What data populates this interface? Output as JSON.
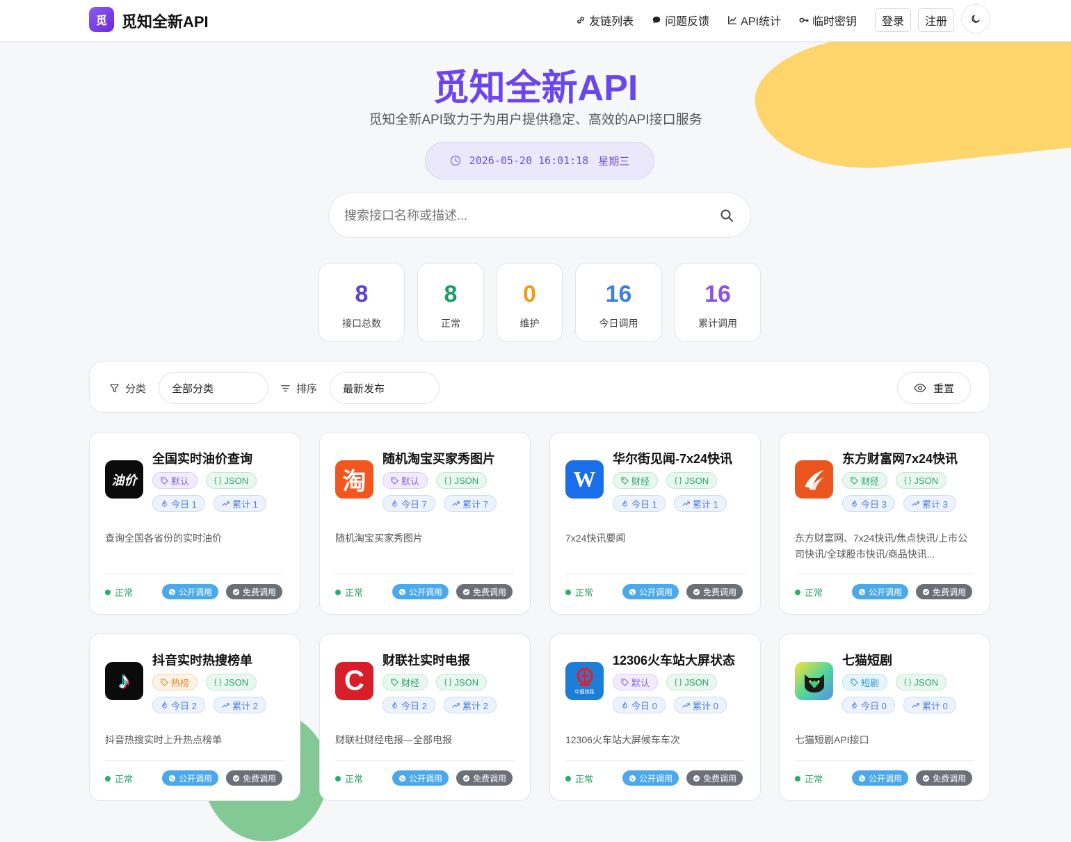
{
  "nav": {
    "brand_icon_text": "觅",
    "brand": "觅知全新API",
    "links": [
      "友链列表",
      "问题反馈",
      "API统计",
      "临时密钥"
    ],
    "login": "登录",
    "register": "注册"
  },
  "hero": {
    "title": "觅知全新API",
    "subtitle": "觅知全新API致力于为用户提供稳定、高效的API接口服务",
    "datetime": "2026-05-20 16:01:18",
    "weekday": "星期三"
  },
  "search": {
    "placeholder": "搜索接口名称或描述..."
  },
  "stats": [
    {
      "value": "8",
      "label": "接口总数",
      "color": "#5b3fd9"
    },
    {
      "value": "8",
      "label": "正常",
      "color": "#1e9d63"
    },
    {
      "value": "0",
      "label": "维护",
      "color": "#f29b1b"
    },
    {
      "value": "16",
      "label": "今日调用",
      "color": "#3f7fe4"
    },
    {
      "value": "16",
      "label": "累计调用",
      "color": "#8a52e6"
    }
  ],
  "filters": {
    "category_label": "分类",
    "category_value": "全部分类",
    "sort_label": "排序",
    "sort_value": "最新发布",
    "reset": "重置"
  },
  "cards": [
    {
      "title": "全国实时油价查询",
      "icon_text": "油价",
      "category": "默认",
      "format": "JSON",
      "today": "今日 1",
      "total": "累计 1",
      "desc": "查询全国各省份的实时油价",
      "status": "正常",
      "public": "公开调用",
      "free": "免费调用"
    },
    {
      "title": "随机淘宝买家秀图片",
      "icon_text": "淘",
      "category": "默认",
      "format": "JSON",
      "today": "今日 7",
      "total": "累计 7",
      "desc": "随机淘宝买家秀图片",
      "status": "正常",
      "public": "公开调用",
      "free": "免费调用"
    },
    {
      "title": "华尔街见闻-7x24快讯",
      "icon_text": "W",
      "category": "财经",
      "format": "JSON",
      "today": "今日 1",
      "total": "累计 1",
      "desc": "7x24快讯要闻",
      "status": "正常",
      "public": "公开调用",
      "free": "免费调用"
    },
    {
      "title": "东方财富网7x24快讯",
      "icon_text": "",
      "category": "财经",
      "format": "JSON",
      "today": "今日 3",
      "total": "累计 3",
      "desc": "东方财富网、7x24快讯/焦点快讯/上市公司快讯/全球股市快讯/商品快讯...",
      "status": "正常",
      "public": "公开调用",
      "free": "免费调用"
    },
    {
      "title": "抖音实时热搜榜单",
      "icon_text": "♪",
      "category": "热榜",
      "format": "JSON",
      "today": "今日 2",
      "total": "累计 2",
      "desc": "抖音热搜实时上升热点榜单",
      "status": "正常",
      "public": "公开调用",
      "free": "免费调用"
    },
    {
      "title": "财联社实时电报",
      "icon_text": "C",
      "category": "财经",
      "format": "JSON",
      "today": "今日 2",
      "total": "累计 2",
      "desc": "财联社财经电报—全部电报",
      "status": "正常",
      "public": "公开调用",
      "free": "免费调用"
    },
    {
      "title": "12306火车站大屏状态",
      "icon_text": "中国铁路",
      "category": "默认",
      "format": "JSON",
      "today": "今日 0",
      "total": "累计 0",
      "desc": "12306火车站大屏候车车次",
      "status": "正常",
      "public": "公开调用",
      "free": "免费调用"
    },
    {
      "title": "七猫短剧",
      "icon_text": "",
      "category": "短剧",
      "format": "JSON",
      "today": "今日 0",
      "total": "累计 0",
      "desc": "七猫短剧API接口",
      "status": "正常",
      "public": "公开调用",
      "free": "免费调用"
    }
  ]
}
